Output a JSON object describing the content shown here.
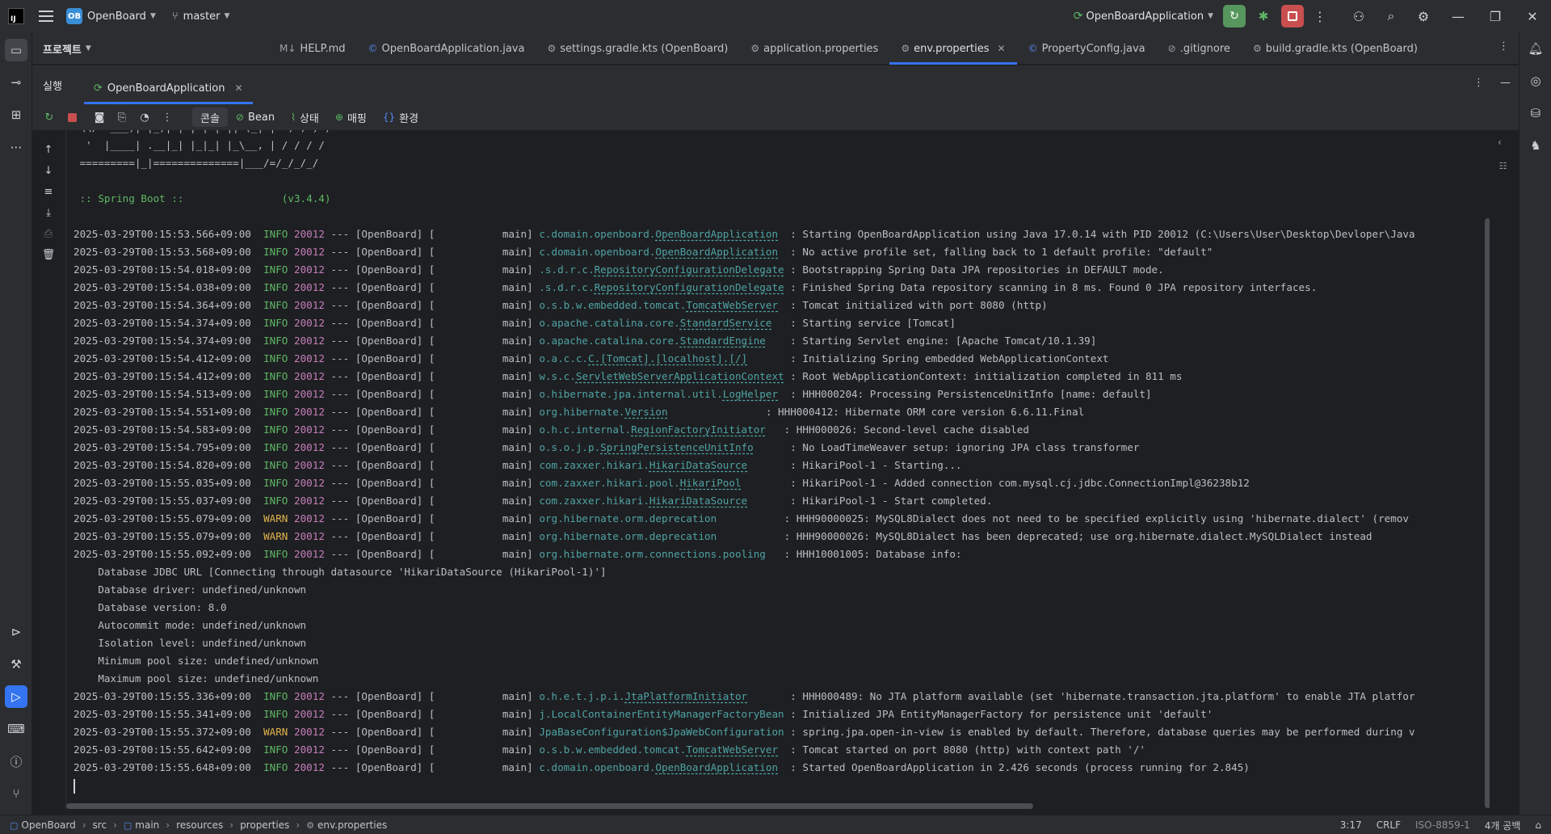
{
  "titlebar": {
    "project_badge": "OB",
    "project_name": "OpenBoard",
    "branch": "master",
    "run_config": "OpenBoardApplication"
  },
  "project_header": {
    "title": "프로젝트"
  },
  "editor_tabs": [
    {
      "label": "HELP.md",
      "icon": "M↓"
    },
    {
      "label": "OpenBoardApplication.java",
      "icon": "©"
    },
    {
      "label": "settings.gradle.kts (OpenBoard)",
      "icon": "⚙"
    },
    {
      "label": "application.properties",
      "icon": "⚙"
    },
    {
      "label": "env.properties",
      "icon": "⚙",
      "active": true
    },
    {
      "label": "PropertyConfig.java",
      "icon": "©"
    },
    {
      "label": ".gitignore",
      "icon": "⊘"
    },
    {
      "label": "build.gradle.kts (OpenBoard)",
      "icon": "⚙"
    }
  ],
  "run_window": {
    "label": "실행",
    "tab": "OpenBoardApplication",
    "subtabs": [
      {
        "label": "콘솔",
        "icon": ""
      },
      {
        "label": "Bean",
        "icon": "⊘"
      },
      {
        "label": "상태",
        "icon": "⌇"
      },
      {
        "label": "매핑",
        "icon": "⊕"
      },
      {
        "label": "환경",
        "icon": "{}"
      }
    ]
  },
  "console": {
    "banner": [
      " \\\\/  ___)| |_)| | | | | || (_| |  ) ) ) )",
      "  '  |____| .__|_| |_|_| |_\\__, | / / / /",
      " =========|_|==============|___/=/_/_/_/",
      "",
      " :: Spring Boot ::                (v3.4.4)",
      ""
    ],
    "logs": [
      {
        "ts": "2025-03-29T00:15:53.566+09:00",
        "level": "INFO",
        "pid": "20012",
        "thread": "main",
        "logger_pkg": "c.domain.openboard.",
        "logger_cls": "OpenBoardApplication",
        "pad": "  ",
        "msg": ": Starting OpenBoardApplication using Java 17.0.14 with PID 20012 (C:\\Users\\User\\Desktop\\Devloper\\Java"
      },
      {
        "ts": "2025-03-29T00:15:53.568+09:00",
        "level": "INFO",
        "pid": "20012",
        "thread": "main",
        "logger_pkg": "c.domain.openboard.",
        "logger_cls": "OpenBoardApplication",
        "pad": "  ",
        "msg": ": No active profile set, falling back to 1 default profile: \"default\""
      },
      {
        "ts": "2025-03-29T00:15:54.018+09:00",
        "level": "INFO",
        "pid": "20012",
        "thread": "main",
        "logger_pkg": ".s.d.r.c.",
        "logger_cls": "RepositoryConfigurationDelegate",
        "pad": " ",
        "msg": ": Bootstrapping Spring Data JPA repositories in DEFAULT mode."
      },
      {
        "ts": "2025-03-29T00:15:54.038+09:00",
        "level": "INFO",
        "pid": "20012",
        "thread": "main",
        "logger_pkg": ".s.d.r.c.",
        "logger_cls": "RepositoryConfigurationDelegate",
        "pad": " ",
        "msg": ": Finished Spring Data repository scanning in 8 ms. Found 0 JPA repository interfaces."
      },
      {
        "ts": "2025-03-29T00:15:54.364+09:00",
        "level": "INFO",
        "pid": "20012",
        "thread": "main",
        "logger_pkg": "o.s.b.w.embedded.tomcat.",
        "logger_cls": "TomcatWebServer",
        "pad": "  ",
        "msg": ": Tomcat initialized with port 8080 (http)"
      },
      {
        "ts": "2025-03-29T00:15:54.374+09:00",
        "level": "INFO",
        "pid": "20012",
        "thread": "main",
        "logger_pkg": "o.apache.catalina.core.",
        "logger_cls": "StandardService",
        "pad": "   ",
        "msg": ": Starting service [Tomcat]"
      },
      {
        "ts": "2025-03-29T00:15:54.374+09:00",
        "level": "INFO",
        "pid": "20012",
        "thread": "main",
        "logger_pkg": "o.apache.catalina.core.",
        "logger_cls": "StandardEngine",
        "pad": "    ",
        "msg": ": Starting Servlet engine: [Apache Tomcat/10.1.39]"
      },
      {
        "ts": "2025-03-29T00:15:54.412+09:00",
        "level": "INFO",
        "pid": "20012",
        "thread": "main",
        "logger_pkg": "o.a.c.c.",
        "logger_cls": "C.[Tomcat].[localhost].[/]",
        "pad": "       ",
        "msg": ": Initializing Spring embedded WebApplicationContext"
      },
      {
        "ts": "2025-03-29T00:15:54.412+09:00",
        "level": "INFO",
        "pid": "20012",
        "thread": "main",
        "logger_pkg": "w.s.c.",
        "logger_cls": "ServletWebServerApplicationContext",
        "pad": " ",
        "msg": ": Root WebApplicationContext: initialization completed in 811 ms"
      },
      {
        "ts": "2025-03-29T00:15:54.513+09:00",
        "level": "INFO",
        "pid": "20012",
        "thread": "main",
        "logger_pkg": "o.hibernate.jpa.internal.util.",
        "logger_cls": "LogHelper",
        "pad": "  ",
        "msg": ": HHH000204: Processing PersistenceUnitInfo [name: default]"
      },
      {
        "ts": "2025-03-29T00:15:54.551+09:00",
        "level": "INFO",
        "pid": "20012",
        "thread": "main",
        "logger_pkg": "org.hibernate.",
        "logger_cls": "Version",
        "pad": "                ",
        "msg": ": HHH000412: Hibernate ORM core version 6.6.11.Final"
      },
      {
        "ts": "2025-03-29T00:15:54.583+09:00",
        "level": "INFO",
        "pid": "20012",
        "thread": "main",
        "logger_pkg": "o.h.c.internal.",
        "logger_cls": "RegionFactoryInitiator",
        "pad": "   ",
        "msg": ": HHH000026: Second-level cache disabled"
      },
      {
        "ts": "2025-03-29T00:15:54.795+09:00",
        "level": "INFO",
        "pid": "20012",
        "thread": "main",
        "logger_pkg": "o.s.o.j.p.",
        "logger_cls": "SpringPersistenceUnitInfo",
        "pad": "      ",
        "msg": ": No LoadTimeWeaver setup: ignoring JPA class transformer"
      },
      {
        "ts": "2025-03-29T00:15:54.820+09:00",
        "level": "INFO",
        "pid": "20012",
        "thread": "main",
        "logger_pkg": "com.zaxxer.hikari.",
        "logger_cls": "HikariDataSource",
        "pad": "       ",
        "msg": ": HikariPool-1 - Starting..."
      },
      {
        "ts": "2025-03-29T00:15:55.035+09:00",
        "level": "INFO",
        "pid": "20012",
        "thread": "main",
        "logger_pkg": "com.zaxxer.hikari.pool.",
        "logger_cls": "HikariPool",
        "pad": "        ",
        "msg": ": HikariPool-1 - Added connection com.mysql.cj.jdbc.ConnectionImpl@36238b12"
      },
      {
        "ts": "2025-03-29T00:15:55.037+09:00",
        "level": "INFO",
        "pid": "20012",
        "thread": "main",
        "logger_pkg": "com.zaxxer.hikari.",
        "logger_cls": "HikariDataSource",
        "pad": "       ",
        "msg": ": HikariPool-1 - Start completed."
      },
      {
        "ts": "2025-03-29T00:15:55.079+09:00",
        "level": "WARN",
        "pid": "20012",
        "thread": "main",
        "logger_pkg": "org.hibernate.orm.deprecation",
        "logger_cls": "",
        "pad": "           ",
        "msg": ": HHH90000025: MySQL8Dialect does not need to be specified explicitly using 'hibernate.dialect' (remov"
      },
      {
        "ts": "2025-03-29T00:15:55.079+09:00",
        "level": "WARN",
        "pid": "20012",
        "thread": "main",
        "logger_pkg": "org.hibernate.orm.deprecation",
        "logger_cls": "",
        "pad": "           ",
        "msg": ": HHH90000026: MySQL8Dialect has been deprecated; use org.hibernate.dialect.MySQLDialect instead"
      },
      {
        "ts": "2025-03-29T00:15:55.092+09:00",
        "level": "INFO",
        "pid": "20012",
        "thread": "main",
        "logger_pkg": "org.hibernate.orm.connections.pooling",
        "logger_cls": "",
        "pad": "   ",
        "msg": ": HHH10001005: Database info:"
      }
    ],
    "db_info": [
      "    Database JDBC URL [Connecting through datasource 'HikariDataSource (HikariPool-1)']",
      "    Database driver: undefined/unknown",
      "    Database version: 8.0",
      "    Autocommit mode: undefined/unknown",
      "    Isolation level: undefined/unknown",
      "    Minimum pool size: undefined/unknown",
      "    Maximum pool size: undefined/unknown"
    ],
    "logs2": [
      {
        "ts": "2025-03-29T00:15:55.336+09:00",
        "level": "INFO",
        "pid": "20012",
        "thread": "main",
        "logger_pkg": "o.h.e.t.j.p.i.",
        "logger_cls": "JtaPlatformInitiator",
        "pad": "       ",
        "msg": ": HHH000489: No JTA platform available (set 'hibernate.transaction.jta.platform' to enable JTA platfor"
      },
      {
        "ts": "2025-03-29T00:15:55.341+09:00",
        "level": "INFO",
        "pid": "20012",
        "thread": "main",
        "logger_pkg": "j.LocalContainerEntityManagerFactoryBean",
        "logger_cls": "",
        "pad": " ",
        "msg": ": Initialized JPA EntityManagerFactory for persistence unit 'default'"
      },
      {
        "ts": "2025-03-29T00:15:55.372+09:00",
        "level": "WARN",
        "pid": "20012",
        "thread": "main",
        "logger_pkg": "JpaBaseConfiguration$JpaWebConfiguration",
        "logger_cls": "",
        "pad": " ",
        "msg": ": spring.jpa.open-in-view is enabled by default. Therefore, database queries may be performed during v"
      },
      {
        "ts": "2025-03-29T00:15:55.642+09:00",
        "level": "INFO",
        "pid": "20012",
        "thread": "main",
        "logger_pkg": "o.s.b.w.embedded.tomcat.",
        "logger_cls": "TomcatWebServer",
        "pad": "  ",
        "msg": ": Tomcat started on port 8080 (http) with context path '/'"
      },
      {
        "ts": "2025-03-29T00:15:55.648+09:00",
        "level": "INFO",
        "pid": "20012",
        "thread": "main",
        "logger_pkg": "c.domain.openboard.",
        "logger_cls": "OpenBoardApplication",
        "pad": "  ",
        "msg": ": Started OpenBoardApplication in 2.426 seconds (process running for 2.845)"
      }
    ]
  },
  "statusbar": {
    "crumbs": [
      {
        "label": "OpenBoard",
        "icon": "▢"
      },
      {
        "label": "src",
        "icon": ""
      },
      {
        "label": "main",
        "icon": "▢"
      },
      {
        "label": "resources",
        "icon": ""
      },
      {
        "label": "properties",
        "icon": ""
      },
      {
        "label": "env.properties",
        "icon": "⚙"
      }
    ],
    "position": "3:17",
    "line_sep": "CRLF",
    "encoding": "ISO-8859-1",
    "indent": "4개 공백"
  },
  "colors": {
    "accent": "#3574f0",
    "run_green": "#57965c",
    "stop_red": "#c94f4f",
    "info": "#5fb865",
    "warn": "#e0b24c",
    "logger": "#4fa3a5"
  }
}
